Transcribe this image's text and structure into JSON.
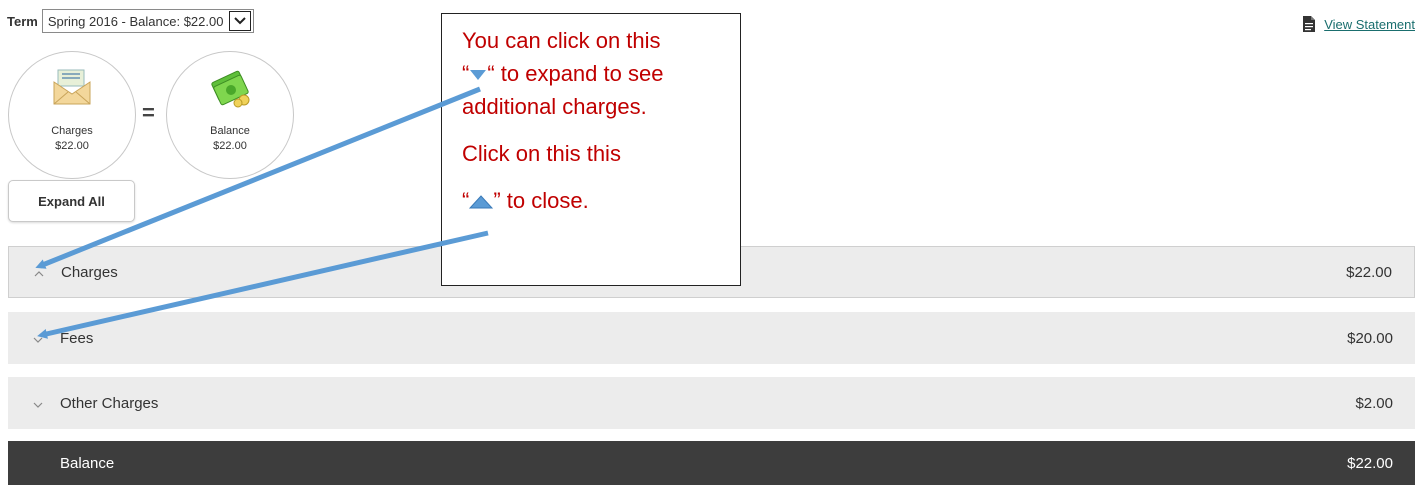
{
  "term": {
    "label": "Term",
    "selected": "Spring 2016 - Balance: $22.00"
  },
  "view_statement": {
    "label": "View Statement"
  },
  "summary": {
    "charges": {
      "label": "Charges",
      "amount": "$22.00",
      "icon": "envelope-money-icon"
    },
    "operator": "=",
    "balance": {
      "label": "Balance",
      "amount": "$22.00",
      "icon": "cash-icon"
    }
  },
  "expand_all_label": "Expand All",
  "rows": [
    {
      "name": "Charges",
      "amount": "$22.00",
      "state": "expanded"
    },
    {
      "name": "Fees",
      "amount": "$20.00",
      "state": "collapsed"
    },
    {
      "name": "Other Charges",
      "amount": "$2.00",
      "state": "collapsed"
    },
    {
      "name": "Balance",
      "amount": "$22.00",
      "state": "total"
    }
  ],
  "callout": {
    "line1": "You can click  on this",
    "line2_pre": "“",
    "line2_post": "“ to expand to see",
    "line3": "additional charges.",
    "line4": "Click on this this",
    "line5_pre": "“",
    "line5_post": "” to close."
  },
  "colors": {
    "callout_text": "#c00000",
    "arrow": "#5b9bd5",
    "balance_row": "#3d3d3d",
    "row_bg": "#ececec"
  }
}
